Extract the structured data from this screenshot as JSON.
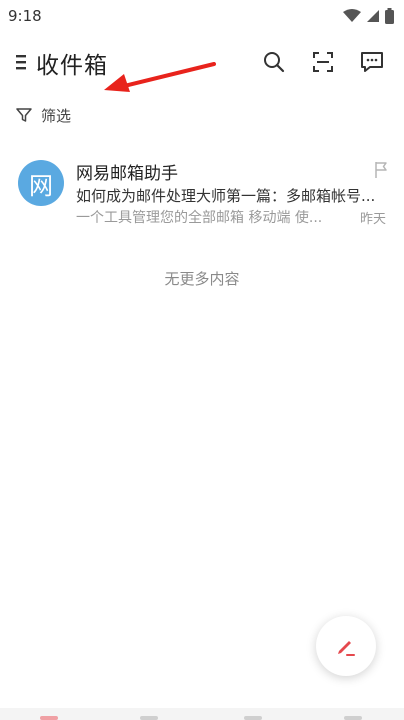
{
  "status_bar": {
    "time": "9:18",
    "icons": [
      "wifi-icon",
      "signal-icon",
      "battery-icon"
    ]
  },
  "header": {
    "title": "收件箱",
    "actions": [
      "search-icon",
      "scan-icon",
      "message-icon"
    ]
  },
  "filter": {
    "label": "筛选"
  },
  "mail_list": [
    {
      "avatar_text": "网",
      "avatar_color": "#5aa9e1",
      "sender": "网易邮箱助手",
      "subject": "如何成为邮件处理大师第一篇：多邮箱帐号...",
      "preview": "一个工具管理您的全部邮箱 移动端 使...",
      "date": "昨天",
      "flag_icon": "flag-icon"
    }
  ],
  "list_footer": "无更多内容",
  "fab": {
    "icon": "compose-icon",
    "accent_color": "#e5484d"
  },
  "annotation": {
    "arrow_color": "#e8231c"
  }
}
